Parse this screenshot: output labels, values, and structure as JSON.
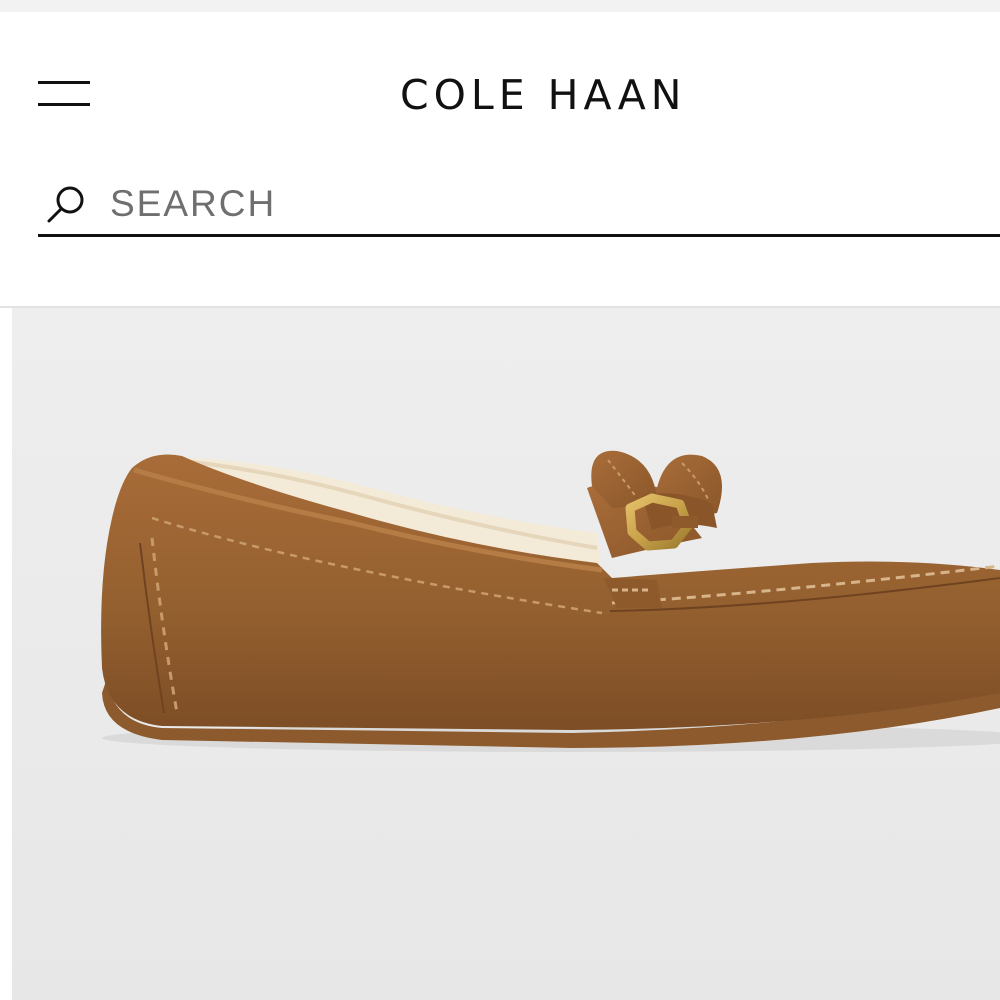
{
  "header": {
    "brand": "COLE HAAN",
    "menu_icon": "hamburger-menu-icon"
  },
  "search": {
    "placeholder": "SEARCH",
    "value": "",
    "icon": "search-icon"
  },
  "product": {
    "image_subject": "suede-moccasin-loafer",
    "colors": {
      "suede": "#9a6233",
      "suede_shadow": "#7a4a24",
      "lining": "#f4ead8",
      "hardware": "#c9a24a",
      "background": "#ececec"
    }
  }
}
